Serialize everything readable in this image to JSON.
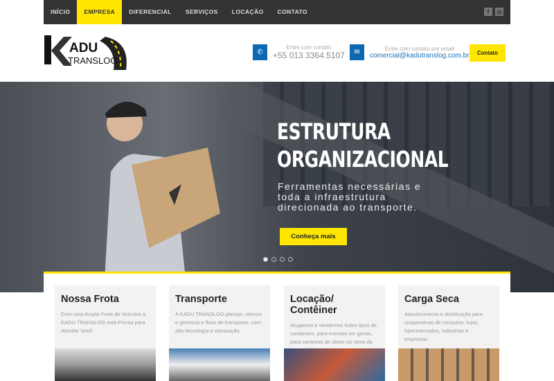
{
  "nav": {
    "items": [
      "INÍCIO",
      "EMPRESA",
      "DIFERENCIAL",
      "SERVIÇOS",
      "LOCAÇÃO",
      "CONTATO"
    ],
    "active": 1,
    "social": [
      "facebook-icon",
      "instagram-icon"
    ]
  },
  "logo": {
    "text_top": "ADU",
    "text_bottom": "TRANSLOG",
    "initial": "K"
  },
  "contact": {
    "phone_label": "Entre com contato",
    "phone": "+55 013 3364.5107",
    "email_label": "Entre com contato por email",
    "email": "comercial@kadutranslog.com.br",
    "button": "Contato"
  },
  "hero": {
    "title_line1": "ESTRUTURA",
    "title_line2": "ORGANIZACIONAL",
    "subtitle": "Ferramentas necessárias e toda a infraestrutura direcionada ao transporte.",
    "button": "Conheça mais",
    "slides": 4,
    "active_slide": 0
  },
  "colors": {
    "accent": "#ffe600",
    "nav": "#333333",
    "icon_blue": "#0b68b1"
  },
  "cards": [
    {
      "title": "Nossa Frota",
      "text": "Com uma Ampla Frota de Veículos a KADU TRANSLOG está Pronta para Atender Você."
    },
    {
      "title": "Transporte",
      "text": "A KADU TRANSLOG planeja, otimiza e gerencia o fluxo de transporte, com alta tecnologia e otimização."
    },
    {
      "title": "Locação/ Contêiner",
      "text": "Alugamos e vendemos todos tipos de containers, para eventos em gerais, para canteiros de obras no ramo da construção."
    },
    {
      "title": "Carga Seca",
      "text": "Abastecimento e distribuição para cooperativas de consumo, lojas, hipermercados, indústrias e empresas."
    }
  ]
}
